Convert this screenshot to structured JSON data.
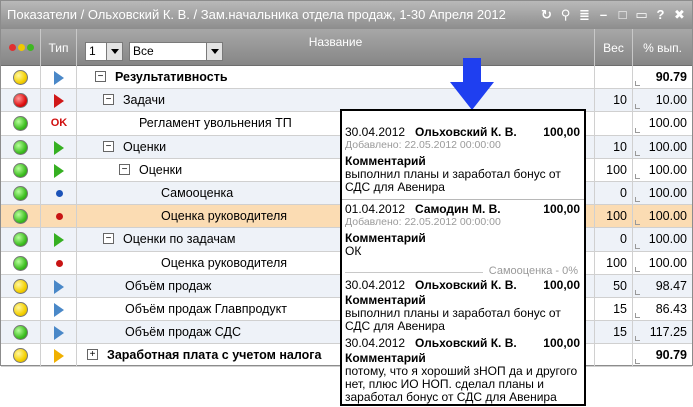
{
  "title": "Показатели / Ольховский К. В. / Зам.начальника отдела продаж, 1-30 Апреля 2012",
  "titlebar_icons": [
    "refresh-icon",
    "search-icon",
    "list-icon",
    "minimize-icon",
    "maximize-icon",
    "close-icon",
    "help-icon",
    "more-icon"
  ],
  "titlebar_glyphs": [
    "↻",
    "⚲",
    "≣",
    "–",
    "□",
    "▭",
    "?",
    "✖"
  ],
  "header": {
    "type": "Тип",
    "level_value": "1",
    "filter_value": "Все",
    "name": "Название",
    "weight": "Вес",
    "percent": "% вып."
  },
  "rows": [
    {
      "light": "y",
      "type": "tri-blue",
      "expander": "⊟",
      "name": "Результативность",
      "bold": true,
      "weight": "",
      "percent": "90.79"
    },
    {
      "light": "r",
      "type": "tri-red",
      "expander": "⊟",
      "name": "Задачи",
      "bold": false,
      "weight": "10",
      "percent": "10.00"
    },
    {
      "light": "g",
      "type": "ok",
      "type_text": "OK",
      "expander": "",
      "name": "Регламент увольнения ТП",
      "bold": false,
      "weight": "",
      "percent": "100.00"
    },
    {
      "light": "g",
      "type": "tri-green",
      "expander": "⊟",
      "name": "Оценки",
      "bold": false,
      "weight": "10",
      "percent": "100.00"
    },
    {
      "light": "g",
      "type": "tri-green",
      "expander": "⊟",
      "name": "Оценки",
      "bold": false,
      "weight": "100",
      "percent": "100.00"
    },
    {
      "light": "g",
      "type": "dot-blue",
      "expander": "",
      "name": "Самооценка",
      "bold": false,
      "weight": "0",
      "percent": "100.00"
    },
    {
      "light": "g",
      "type": "dot-red",
      "expander": "",
      "name": "Оценка руководителя",
      "bold": false,
      "weight": "100",
      "percent": "100.00"
    },
    {
      "light": "g",
      "type": "tri-green",
      "expander": "⊟",
      "name": "Оценки по задачам",
      "bold": false,
      "weight": "0",
      "percent": "100.00"
    },
    {
      "light": "g",
      "type": "dot-red",
      "expander": "",
      "name": "Оценка руководителя",
      "bold": false,
      "weight": "100",
      "percent": "100.00"
    },
    {
      "light": "y",
      "type": "tri-blue",
      "expander": "",
      "name": "Объём продаж",
      "bold": false,
      "weight": "50",
      "percent": "98.47"
    },
    {
      "light": "y",
      "type": "tri-blue",
      "expander": "",
      "name": "Объём продаж Главпродукт",
      "bold": false,
      "weight": "15",
      "percent": "86.43"
    },
    {
      "light": "g",
      "type": "tri-blue",
      "expander": "",
      "name": "Объём продаж СДС",
      "bold": false,
      "weight": "15",
      "percent": "117.25"
    },
    {
      "light": "y",
      "type": "tri-orange",
      "expander": "⊞",
      "name": "Заработная плата с учетом налога",
      "bold": true,
      "weight": "",
      "percent": "90.79"
    }
  ],
  "popup": {
    "entries": [
      {
        "date": "30.04.2012",
        "name": "Ольховский К. В.",
        "value": "100,00",
        "added": "Добавлено: 22.05.2012 00:00:00",
        "comment_title": "Комментарий",
        "comment": "выполнил планы и заработал бонус от СДС для Авенира"
      },
      {
        "date": "01.04.2012",
        "name": "Самодин М. В.",
        "value": "100,00",
        "added": "Добавлено: 22.05.2012 00:00:00",
        "comment_title": "Комментарий",
        "comment": "ОК"
      }
    ],
    "self_label": "Самооценка - 0%",
    "entries2": [
      {
        "date": "30.04.2012",
        "name": "Ольховский К. В.",
        "value": "100,00",
        "comment_title": "Комментарий",
        "comment": "выполнил планы и заработал бонус от СДС для Авенира"
      },
      {
        "date": "30.04.2012",
        "name": "Ольховский К. В.",
        "value": "100,00",
        "comment_title": "Комментарий",
        "comment": "потому, что я хороший зНОП да и другого нет, плюс ИО НОП. сделал планы и заработал бонус от СДС для Авенира"
      }
    ]
  }
}
